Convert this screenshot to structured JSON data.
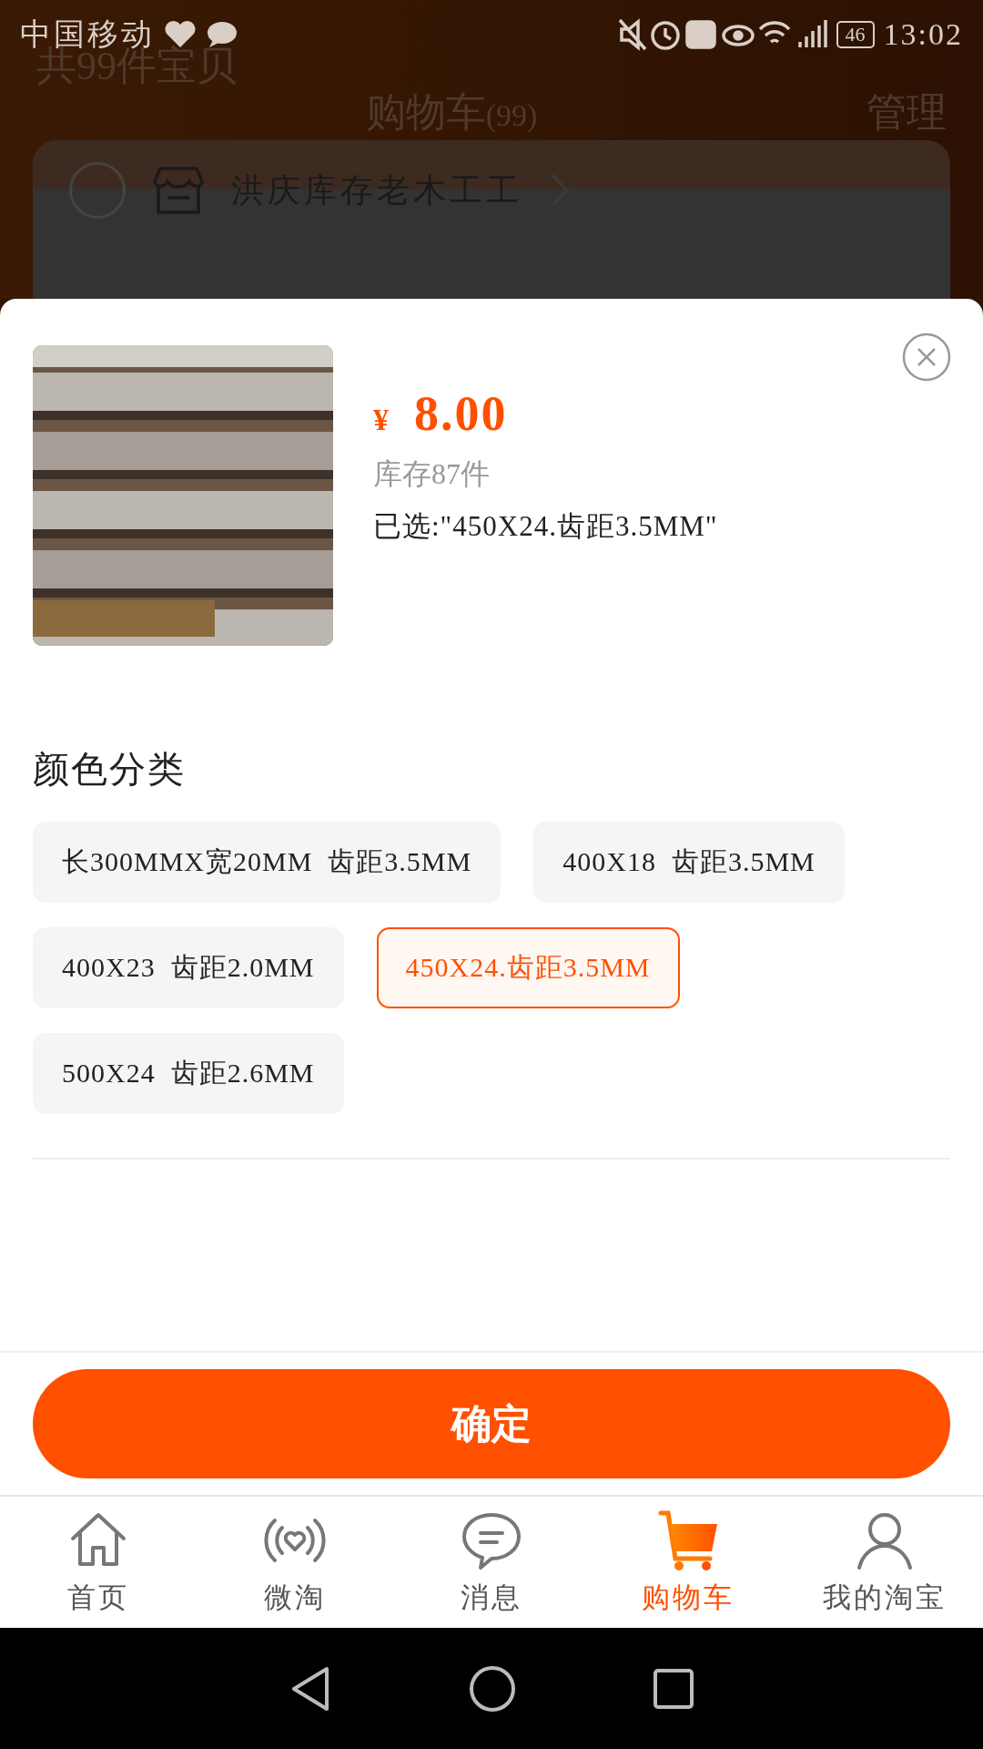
{
  "status_bar": {
    "carrier": "中国移动",
    "battery": "46",
    "time": "13:02"
  },
  "cart_page": {
    "item_count": "共99件宝贝",
    "title": "购物车",
    "title_count": "(99)",
    "manage": "管理",
    "shop": {
      "name": "洪庆库存老木工工",
      "selected": false
    }
  },
  "sku_sheet": {
    "currency": "¥",
    "price": "8.00",
    "stock": "库存87件",
    "selected_text": "已选:\"450X24.齿距3.5MM\"",
    "group_title": "颜色分类",
    "options": [
      {
        "label": "长300MMX宽20MM  齿距3.5MM",
        "selected": false
      },
      {
        "label": "400X18  齿距3.5MM",
        "selected": false
      },
      {
        "label": "400X23  齿距2.0MM",
        "selected": false
      },
      {
        "label": "450X24.齿距3.5MM",
        "selected": true
      },
      {
        "label": "500X24  齿距2.6MM",
        "selected": false
      }
    ],
    "confirm": "确定"
  },
  "tab_bar": [
    {
      "kind": "home",
      "label": "首页",
      "selected": false
    },
    {
      "kind": "feed",
      "label": "微淘",
      "selected": false
    },
    {
      "kind": "message",
      "label": "消息",
      "selected": false
    },
    {
      "kind": "cart",
      "label": "购物车",
      "selected": true
    },
    {
      "kind": "profile",
      "label": "我的淘宝",
      "selected": false
    }
  ]
}
